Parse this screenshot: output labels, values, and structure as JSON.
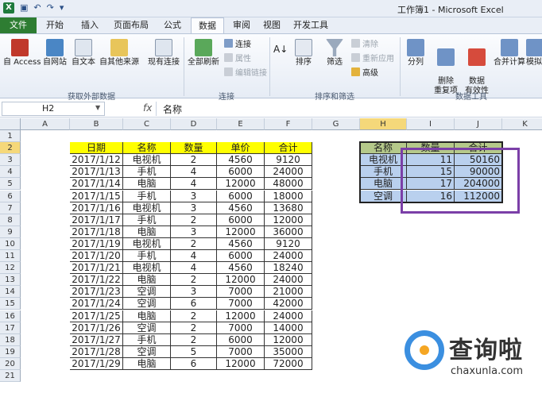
{
  "window": {
    "title": "工作簿1 - Microsoft Excel",
    "qat_icons": [
      "save-icon",
      "undo-icon",
      "redo-icon",
      "customize-icon"
    ]
  },
  "tabs": [
    "文件",
    "开始",
    "插入",
    "页面布局",
    "公式",
    "数据",
    "审阅",
    "视图",
    "开发工具"
  ],
  "active_tab": "数据",
  "ribbon": {
    "get_external": {
      "buttons": [
        "自 Access",
        "自网站",
        "自文本",
        "自其他来源",
        "现有连接"
      ],
      "label": "获取外部数据"
    },
    "connections": {
      "refresh": "全部刷新",
      "small": [
        "连接",
        "属性",
        "编辑链接"
      ],
      "label": "连接"
    },
    "sort_filter": {
      "sort": "排序",
      "filter": "筛选",
      "small": [
        "清除",
        "重新应用",
        "高级"
      ],
      "label": "排序和筛选"
    },
    "data_tools": {
      "buttons": [
        "分列",
        "删除\n重复项",
        "数据\n有效性",
        "合并计算",
        "模拟"
      ],
      "label": "数据工具"
    }
  },
  "formula_bar": {
    "name_box": "H2",
    "fx": "fx",
    "formula": "名称"
  },
  "columns": [
    "A",
    "B",
    "C",
    "D",
    "E",
    "F",
    "G",
    "H",
    "I",
    "J",
    "K"
  ],
  "rows": [
    "1",
    "2",
    "3",
    "4",
    "5",
    "6",
    "7",
    "8",
    "9",
    "10",
    "11",
    "12",
    "13",
    "14",
    "15",
    "16",
    "17",
    "18",
    "19",
    "20",
    "21"
  ],
  "table": {
    "headers": [
      "日期",
      "名称",
      "数量",
      "单价",
      "合计"
    ],
    "rows": [
      [
        "2017/1/12",
        "电视机",
        "2",
        "4560",
        "9120"
      ],
      [
        "2017/1/13",
        "手机",
        "4",
        "6000",
        "24000"
      ],
      [
        "2017/1/14",
        "电脑",
        "4",
        "12000",
        "48000"
      ],
      [
        "2017/1/15",
        "手机",
        "3",
        "6000",
        "18000"
      ],
      [
        "2017/1/16",
        "电视机",
        "3",
        "4560",
        "13680"
      ],
      [
        "2017/1/17",
        "手机",
        "2",
        "6000",
        "12000"
      ],
      [
        "2017/1/18",
        "电脑",
        "3",
        "12000",
        "36000"
      ],
      [
        "2017/1/19",
        "电视机",
        "2",
        "4560",
        "9120"
      ],
      [
        "2017/1/20",
        "手机",
        "4",
        "6000",
        "24000"
      ],
      [
        "2017/1/21",
        "电视机",
        "4",
        "4560",
        "18240"
      ],
      [
        "2017/1/22",
        "电脑",
        "2",
        "12000",
        "24000"
      ],
      [
        "2017/1/23",
        "空调",
        "3",
        "7000",
        "21000"
      ],
      [
        "2017/1/24",
        "空调",
        "6",
        "7000",
        "42000"
      ],
      [
        "2017/1/25",
        "电脑",
        "2",
        "12000",
        "24000"
      ],
      [
        "2017/1/26",
        "空调",
        "2",
        "7000",
        "14000"
      ],
      [
        "2017/1/27",
        "手机",
        "2",
        "6000",
        "12000"
      ],
      [
        "2017/1/28",
        "空调",
        "5",
        "7000",
        "35000"
      ],
      [
        "2017/1/29",
        "电脑",
        "6",
        "12000",
        "72000"
      ]
    ]
  },
  "summary": {
    "headers": [
      "名称",
      "数量",
      "合计"
    ],
    "rows": [
      [
        "电视机",
        "11",
        "50160"
      ],
      [
        "手机",
        "15",
        "90000"
      ],
      [
        "电脑",
        "17",
        "204000"
      ],
      [
        "空调",
        "16",
        "112000"
      ]
    ]
  },
  "watermark": {
    "brand": "查询啦",
    "url": "chaxunla.com"
  },
  "colors": {
    "header_fill": "#ffff00",
    "summary_header_fill": "#b5c98a",
    "selection_fill": "#b9d0ee",
    "highlight_box": "#7b3fa8",
    "file_tab": "#2e7d32"
  }
}
